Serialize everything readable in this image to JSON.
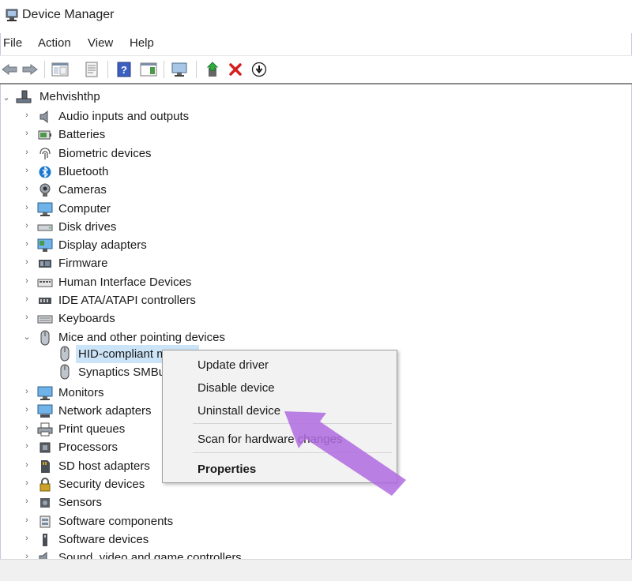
{
  "window": {
    "title": "Device Manager",
    "icon": "device-manager-icon"
  },
  "menu": [
    "File",
    "Action",
    "View",
    "Help"
  ],
  "toolbar": {
    "buttons": [
      "back-icon",
      "forward-icon",
      "show-hide-tree-icon",
      "properties-icon",
      "help-icon",
      "action-pane-icon",
      "scan-hardware-icon",
      "update-driver-icon",
      "uninstall-icon",
      "disable-icon"
    ]
  },
  "tree": {
    "root": "Mehvishthp",
    "items": [
      {
        "label": "Audio inputs and outputs",
        "icon": "speaker-icon"
      },
      {
        "label": "Batteries",
        "icon": "battery-icon"
      },
      {
        "label": "Biometric devices",
        "icon": "fingerprint-icon"
      },
      {
        "label": "Bluetooth",
        "icon": "bluetooth-icon"
      },
      {
        "label": "Cameras",
        "icon": "camera-icon"
      },
      {
        "label": "Computer",
        "icon": "computer-icon"
      },
      {
        "label": "Disk drives",
        "icon": "disk-drive-icon"
      },
      {
        "label": "Display adapters",
        "icon": "display-adapter-icon"
      },
      {
        "label": "Firmware",
        "icon": "firmware-icon"
      },
      {
        "label": "Human Interface Devices",
        "icon": "hid-icon"
      },
      {
        "label": "IDE ATA/ATAPI controllers",
        "icon": "ide-controller-icon"
      },
      {
        "label": "Keyboards",
        "icon": "keyboard-icon"
      },
      {
        "label": "Mice and other pointing devices",
        "icon": "mouse-icon"
      },
      {
        "label": "Monitors",
        "icon": "monitor-icon"
      },
      {
        "label": "Network adapters",
        "icon": "network-adapter-icon"
      },
      {
        "label": "Print queues",
        "icon": "printer-icon"
      },
      {
        "label": "Processors",
        "icon": "processor-icon"
      },
      {
        "label": "SD host adapters",
        "icon": "sd-card-icon"
      },
      {
        "label": "Security devices",
        "icon": "security-device-icon"
      },
      {
        "label": "Sensors",
        "icon": "sensor-icon"
      },
      {
        "label": "Software components",
        "icon": "software-component-icon"
      },
      {
        "label": "Software devices",
        "icon": "software-device-icon"
      },
      {
        "label": "Sound, video and game controllers",
        "icon": "sound-controller-icon"
      }
    ],
    "children_mice": [
      "HID-compliant m",
      "Synaptics SMBu"
    ]
  },
  "context_menu": {
    "update_driver": "Update driver",
    "disable_device": "Disable device",
    "uninstall_device": "Uninstall device",
    "scan_hardware": "Scan for hardware changes",
    "properties": "Properties"
  },
  "colors": {
    "arrow": "#b06be0",
    "selection": "#cce4f7",
    "accent": "#1b78d0"
  }
}
